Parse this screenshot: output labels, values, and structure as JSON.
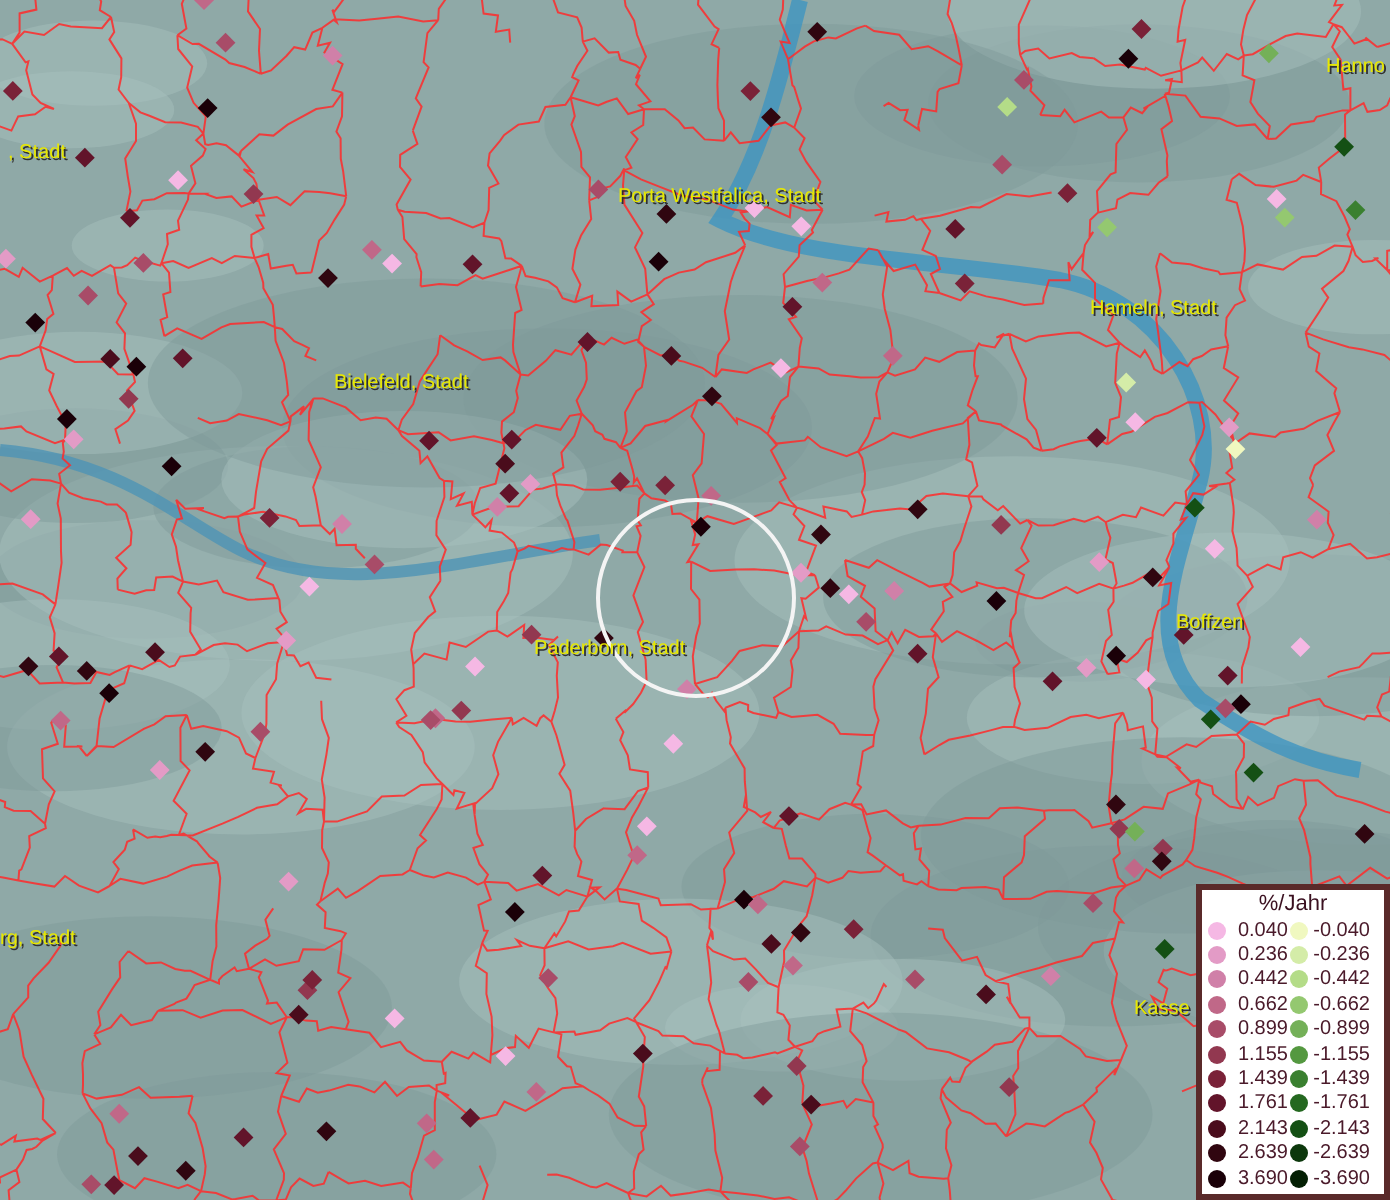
{
  "map": {
    "place_labels": [
      {
        "text": "Hanno"
      },
      {
        "text": ", Stadt"
      },
      {
        "text": "Porta Westfalica, Stadt"
      },
      {
        "text": "Hameln, Stadt"
      },
      {
        "text": "Bielefeld, Stadt"
      },
      {
        "text": "Paderborn, Stadt"
      },
      {
        "text": "Boffzen"
      },
      {
        "text": "rg, Stadt"
      },
      {
        "text": "Kasse"
      }
    ]
  },
  "legend": {
    "title": "%/Jahr",
    "columns": [
      [
        {
          "label": "0.040",
          "color": "#f5b8e4"
        },
        {
          "label": "0.236",
          "color": "#e39bc6"
        },
        {
          "label": "0.442",
          "color": "#d080a8"
        },
        {
          "label": "0.662",
          "color": "#c06888"
        },
        {
          "label": "0.899",
          "color": "#a84c68"
        },
        {
          "label": "1.155",
          "color": "#923850"
        },
        {
          "label": "1.439",
          "color": "#7a2238"
        },
        {
          "label": "1.761",
          "color": "#62142a"
        },
        {
          "label": "2.143",
          "color": "#4a0c1c"
        },
        {
          "label": "2.639",
          "color": "#300610"
        },
        {
          "label": "3.690",
          "color": "#1a0008"
        }
      ],
      [
        {
          "label": "-0.040",
          "color": "#f0f8c0"
        },
        {
          "label": "-0.236",
          "color": "#d4eca8"
        },
        {
          "label": "-0.442",
          "color": "#b4dc88"
        },
        {
          "label": "-0.662",
          "color": "#94c870"
        },
        {
          "label": "-0.899",
          "color": "#74b058"
        },
        {
          "label": "-1.155",
          "color": "#549840"
        },
        {
          "label": "-1.439",
          "color": "#3a8030"
        },
        {
          "label": "-1.761",
          "color": "#246820"
        },
        {
          "label": "-2.143",
          "color": "#145014"
        },
        {
          "label": "-2.639",
          "color": "#0c380c"
        },
        {
          "label": "-3.690",
          "color": "#042004"
        }
      ]
    ]
  }
}
